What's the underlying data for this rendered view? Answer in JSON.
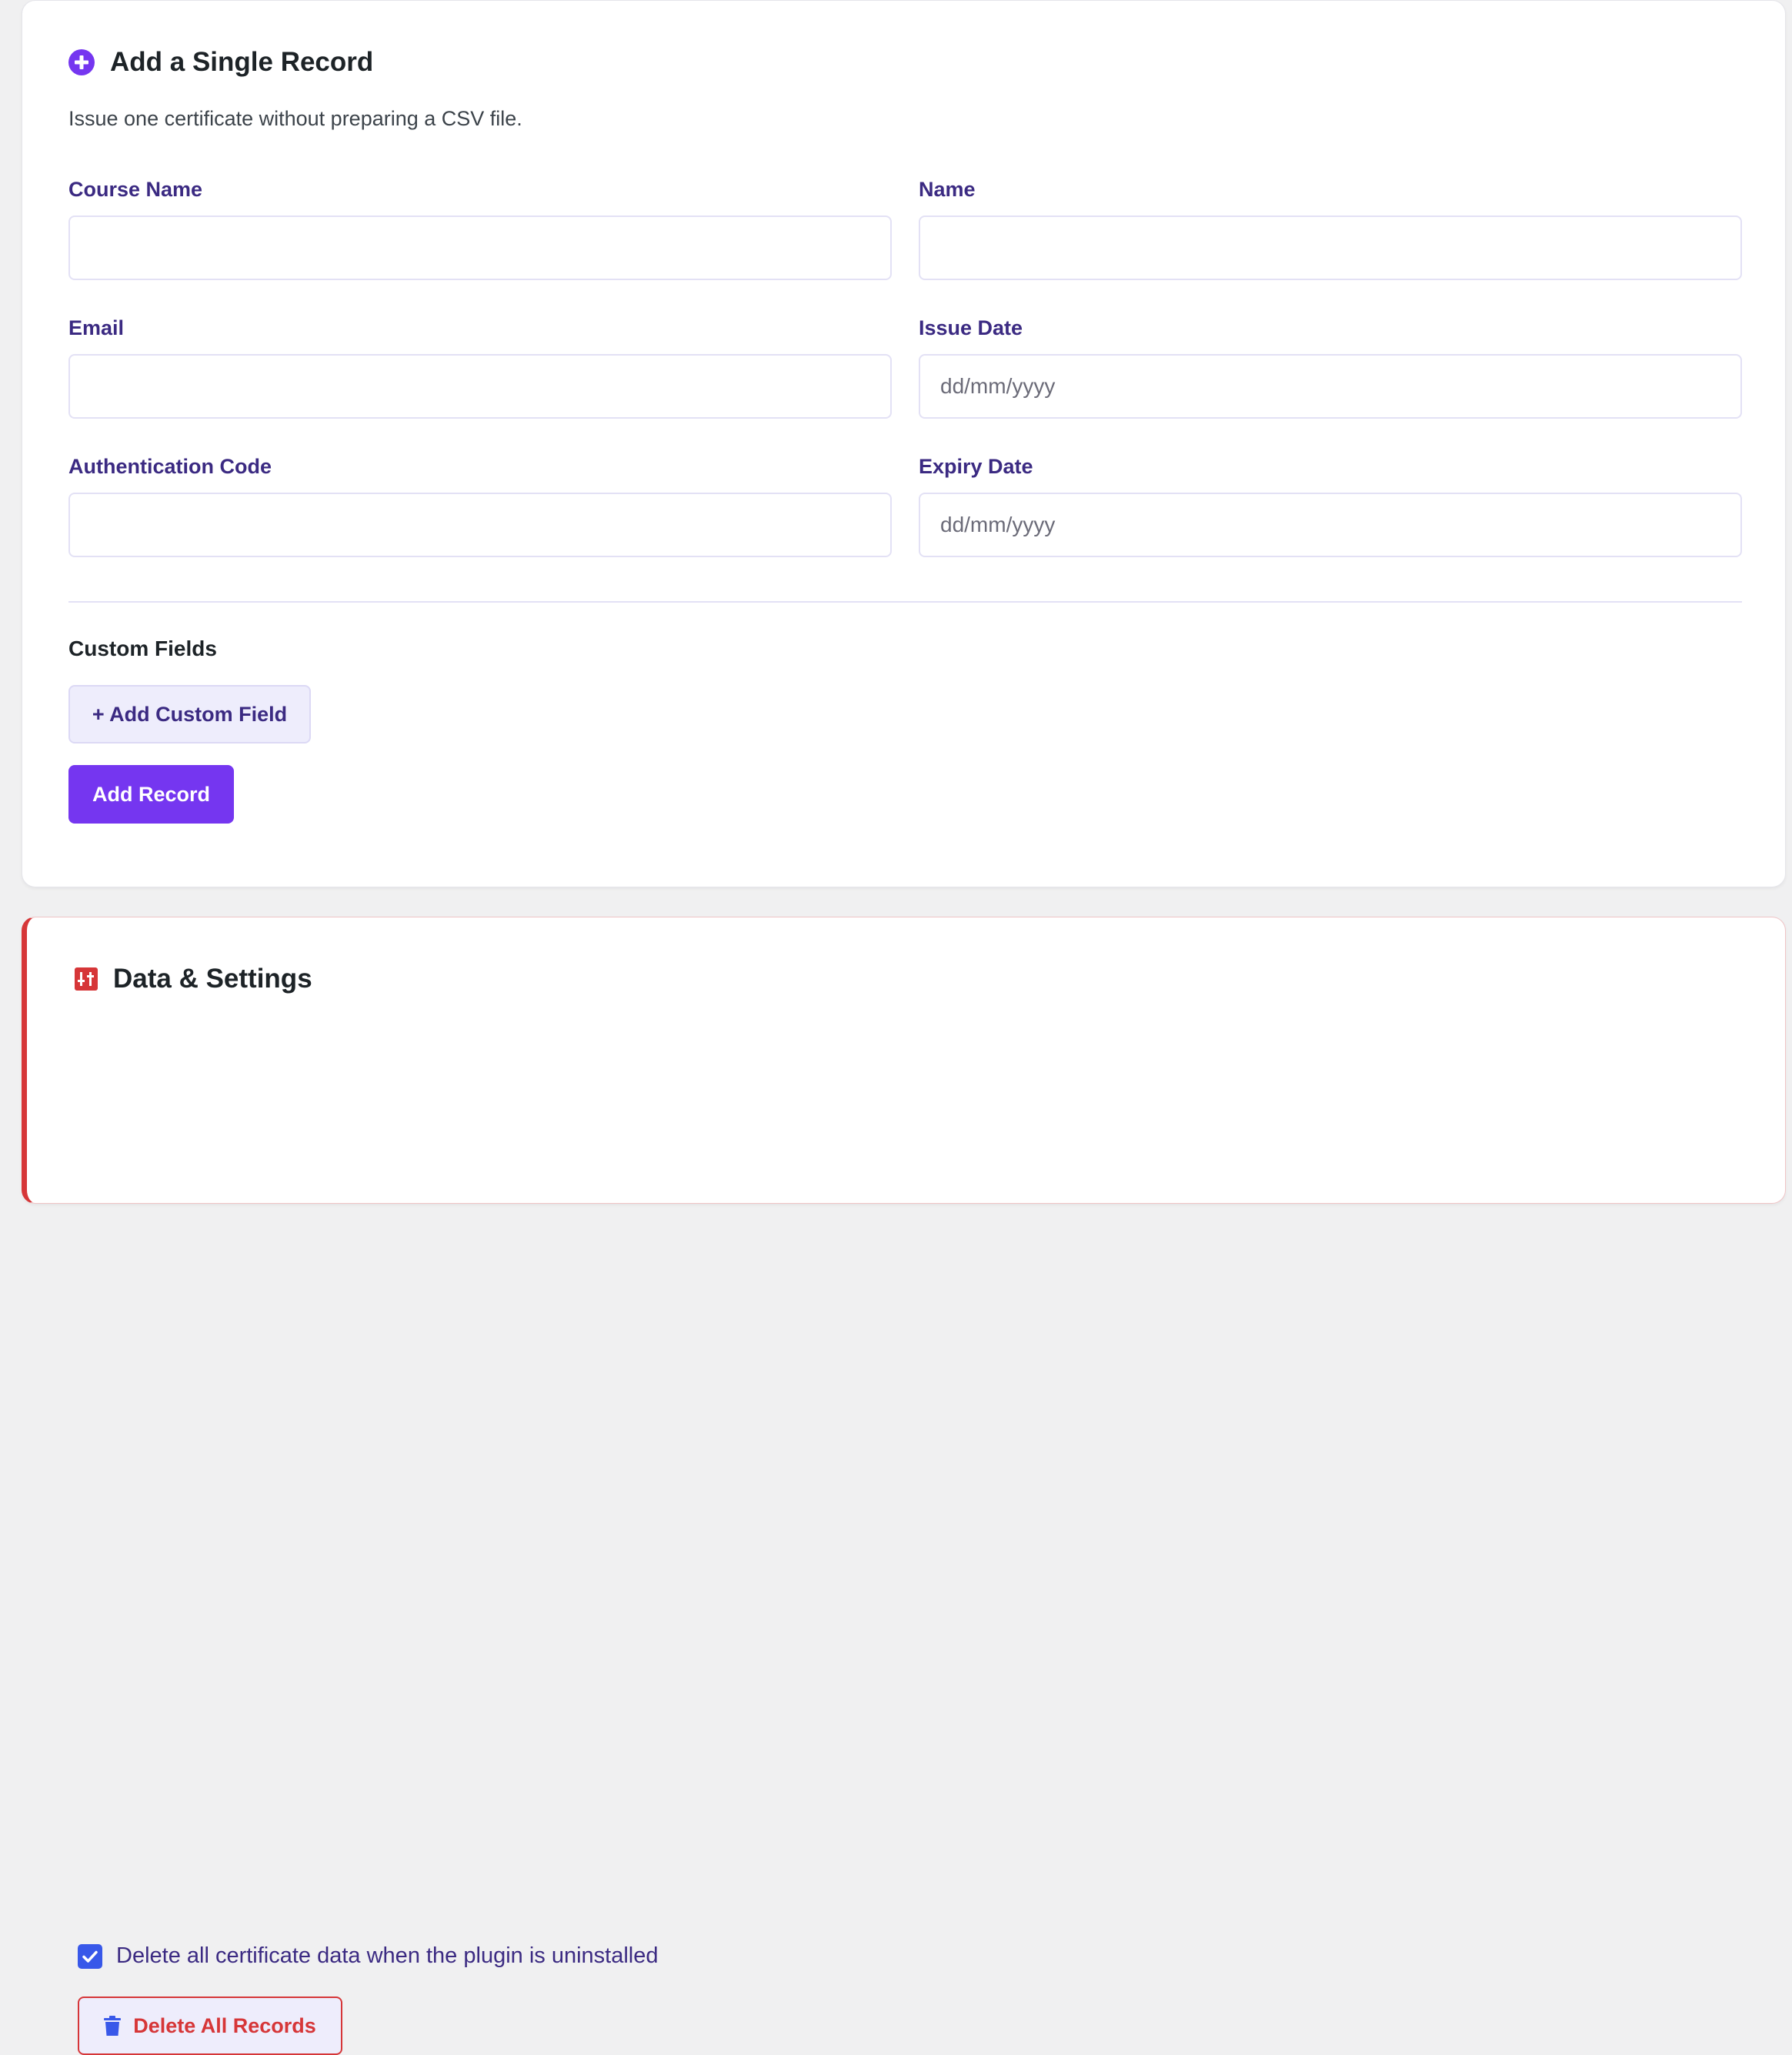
{
  "single_record": {
    "title": "Add a Single Record",
    "icon": "plus-circle-icon",
    "subtitle": "Issue one certificate without preparing a CSV file.",
    "fields": {
      "course_name": {
        "label": "Course Name",
        "value": "",
        "placeholder": ""
      },
      "name": {
        "label": "Name",
        "value": "",
        "placeholder": ""
      },
      "email": {
        "label": "Email",
        "value": "",
        "placeholder": ""
      },
      "issue_date": {
        "label": "Issue Date",
        "value": "",
        "placeholder": "dd/mm/yyyy"
      },
      "auth_code": {
        "label": "Authentication Code",
        "value": "",
        "placeholder": ""
      },
      "expiry_date": {
        "label": "Expiry Date",
        "value": "",
        "placeholder": "dd/mm/yyyy"
      }
    },
    "custom_fields_label": "Custom Fields",
    "add_custom_field_label": "+ Add Custom Field",
    "add_record_label": "Add Record"
  },
  "settings": {
    "title": "Data & Settings",
    "icon": "sliders-icon",
    "delete_on_uninstall_label": "Delete all certificate data when the plugin is uninstalled",
    "delete_on_uninstall_checked": true,
    "delete_all_label": "Delete All Records"
  },
  "colors": {
    "accent": "#7536f0",
    "label": "#3b2a82",
    "danger": "#d63638",
    "checkbox": "#3858e9"
  }
}
